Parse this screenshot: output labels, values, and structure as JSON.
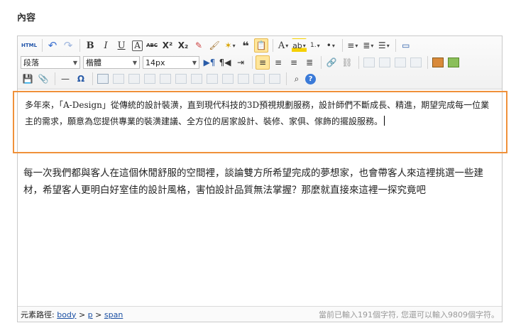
{
  "section": {
    "title": "內容"
  },
  "toolbar": {
    "html_label": "HTML",
    "bold_label": "B",
    "italic_label": "I",
    "underline_label": "U",
    "fontborder_label": "A",
    "strike_label": "ABC",
    "superscript_label": "X²",
    "subscript_label": "X₂",
    "quote_label": "❝",
    "forecolor_label": "A",
    "backcolor_label": "ab",
    "orderedlist_label": "1.",
    "bulletlist_label": "•",
    "paragraph_select": "段落",
    "fontfamily_select": "楷體",
    "fontsize_select": "14px",
    "omega_label": "Ω"
  },
  "content": {
    "paragraph1": "多年來，「A-Design」從傳統的設計裝潢，直到現代科技的3D預視規劃服務，設計師們不斷成長、精進，期望完成每一位業主的需求，願意為您提供專業的裝潢建議、全方位的居家設計、裝修、家俱、傢飾的擺設服務。",
    "paragraph2": "每一次我們都與客人在這個休閒舒服的空間裡，談論雙方所希望完成的夢想家，也會帶客人來這裡挑選一些建材，希望客人更明白好室佳的設計風格，害怕設計品質無法掌握？那麼就直接來這裡一探究竟吧"
  },
  "statusbar": {
    "path_label": "元素路徑:",
    "path": [
      "body",
      "p",
      "span"
    ],
    "separator": ">",
    "word_count": "當前已輸入191個字符, 您還可以輸入9809個字符。"
  }
}
